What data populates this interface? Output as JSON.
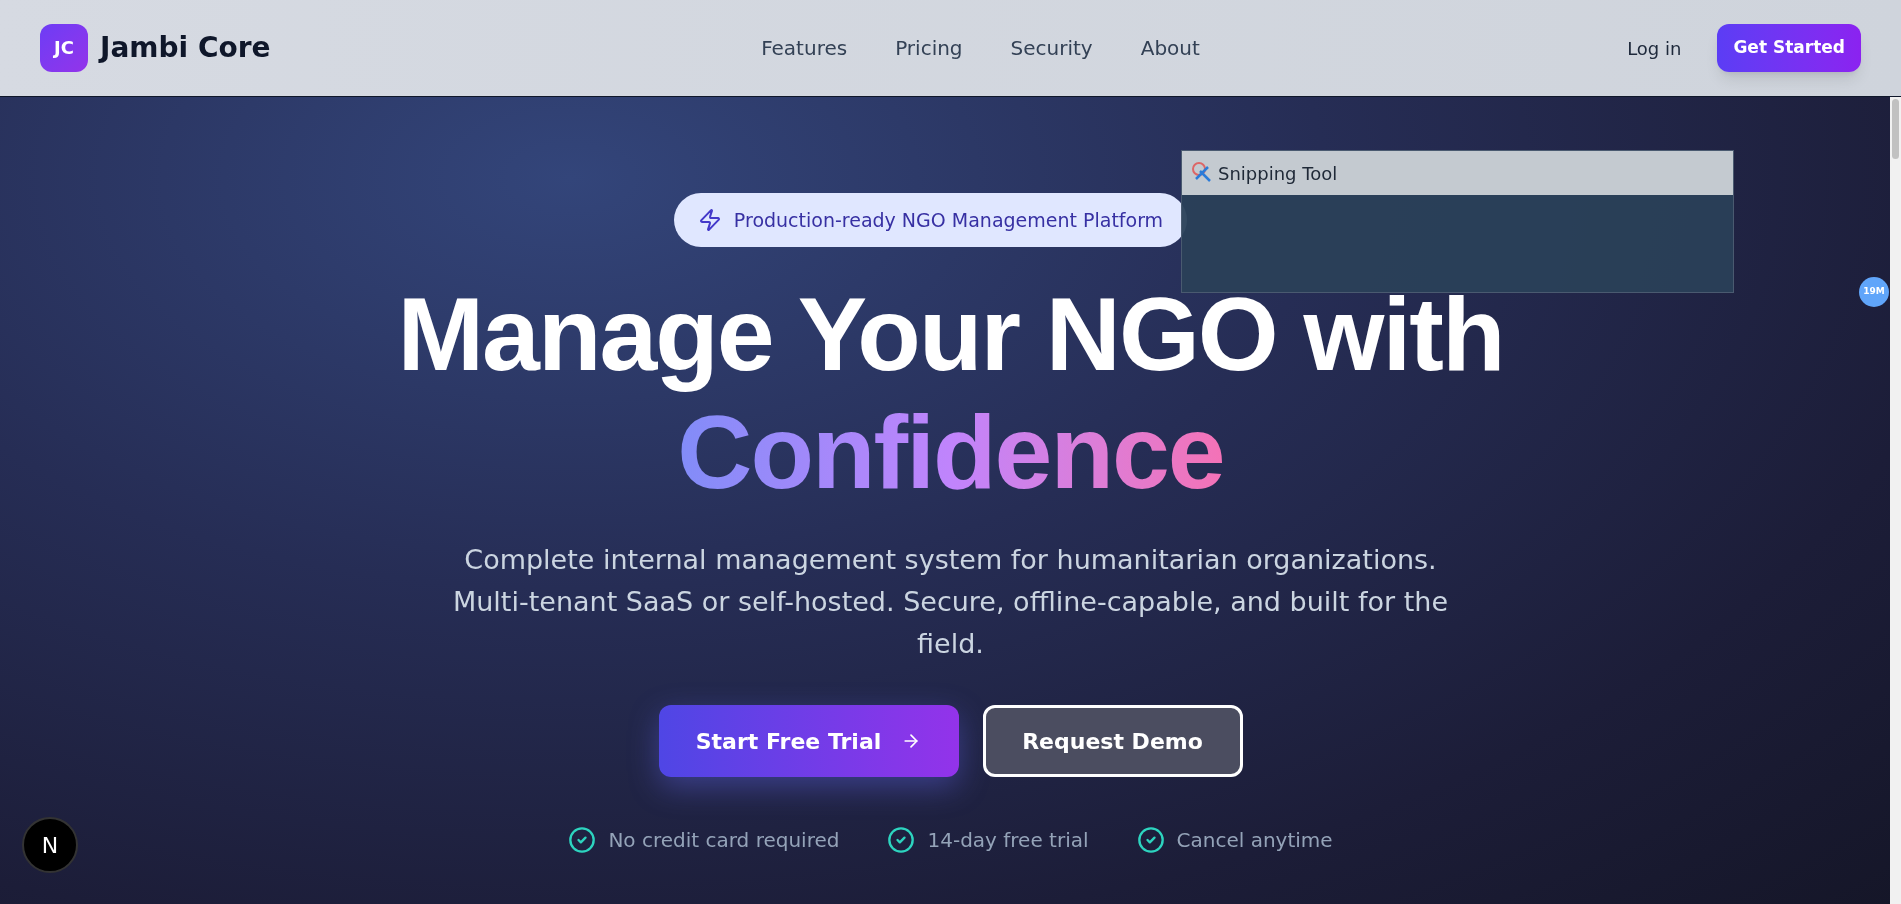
{
  "header": {
    "logo_mark": "JC",
    "brand": "Jambi Core",
    "nav": [
      "Features",
      "Pricing",
      "Security",
      "About"
    ],
    "login": "Log in",
    "cta": "Get Started"
  },
  "hero": {
    "badge": "Production-ready NGO Management Platform",
    "title_line1": "Manage Your NGO with",
    "title_line2": "Confidence",
    "subtitle": "Complete internal management system for humanitarian organizations. Multi-tenant SaaS or self-hosted. Secure, offline-capable, and built for the field.",
    "primary_button": "Start Free Trial",
    "secondary_button": "Request Demo",
    "checks": [
      "No credit card required",
      "14-day free trial",
      "Cancel anytime"
    ]
  },
  "snipping_tool": {
    "title": "Snipping Tool"
  },
  "side_badge": "19M",
  "dev_badge": "N"
}
